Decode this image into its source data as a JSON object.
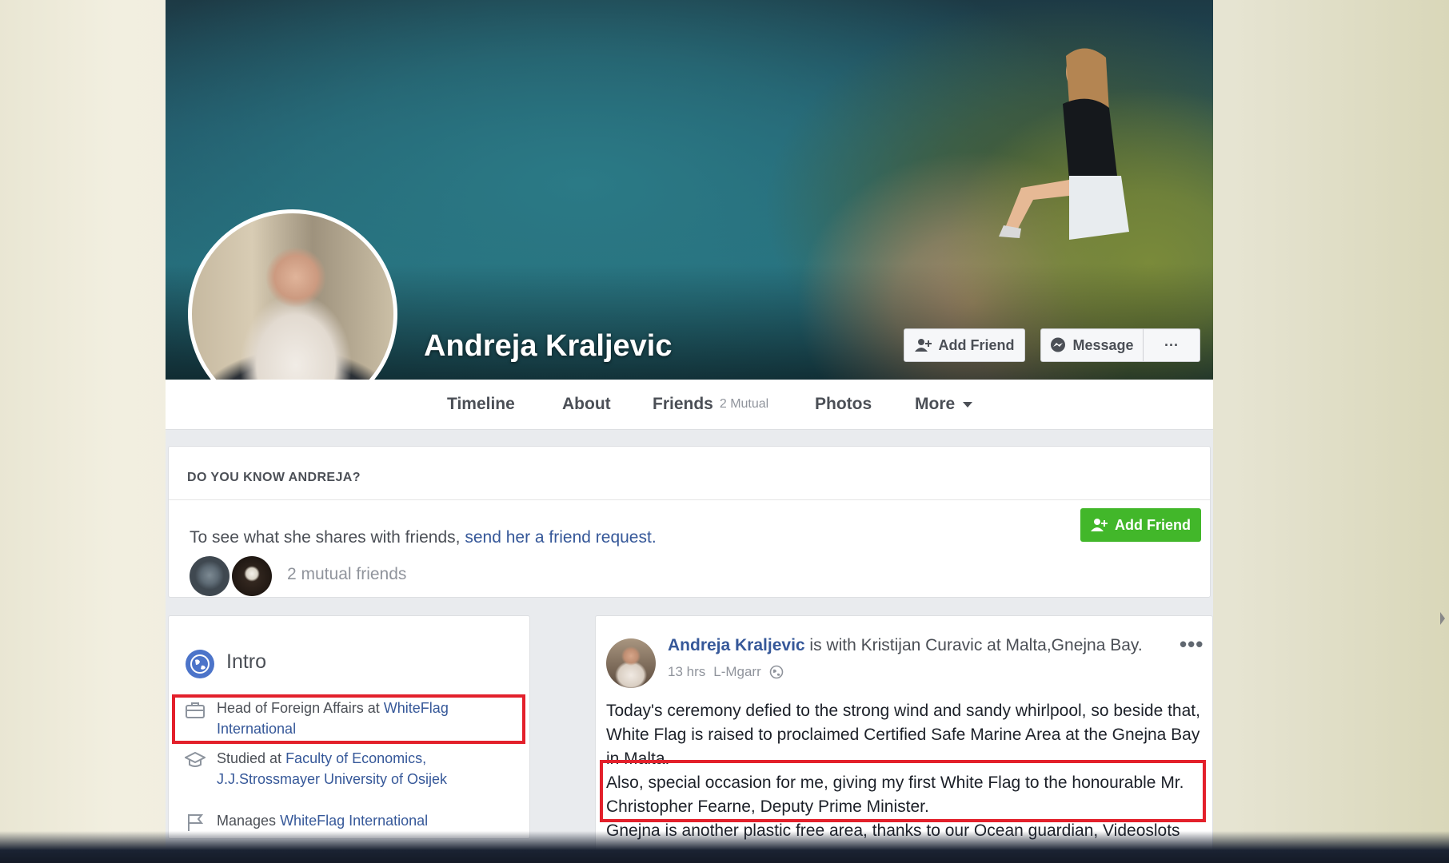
{
  "profile": {
    "name": "Andreja Kraljevic",
    "add_friend_label": "Add Friend",
    "message_label": "Message",
    "more_dots": "···"
  },
  "nav": {
    "timeline": "Timeline",
    "about": "About",
    "friends": "Friends",
    "friends_mutual": "2 Mutual",
    "photos": "Photos",
    "more": "More"
  },
  "know": {
    "title": "DO YOU KNOW ANDREJA?",
    "text_prefix": "To see what she shares with friends, ",
    "text_link": "send her a friend request.",
    "add_friend_label": "Add Friend",
    "mutual_friends": "2 mutual friends"
  },
  "intro": {
    "title": "Intro",
    "work_prefix": "Head of Foreign Affairs at ",
    "work_link": "WhiteFlag International",
    "edu_prefix": "Studied at ",
    "edu_link": "Faculty of Economics, J.J.Strossmayer University of Osijek",
    "manages_prefix": "Manages ",
    "manages_link": "WhiteFlag International"
  },
  "post": {
    "author": "Andreja Kraljevic",
    "header_rest": " is with Kristijan Curavic at Malta,Gnejna Bay.",
    "time": "13 hrs",
    "location": "L-Mgarr",
    "menu_dots": "•••",
    "paragraph1": "Today's ceremony defied to the strong wind and sandy whirlpool, so beside that, White Flag is raised to proclaimed Certified Safe Marine Area at the Gnejna Bay in Malta.",
    "paragraph2": "Also, special occasion for me, giving my first White Flag to the honourable Mr. Christopher Fearne, Deputy Prime Minister.",
    "paragraph3": "Gnejna is another plastic free area, thanks to our Ocean guardian, Videoslots"
  },
  "colors": {
    "link": "#365899",
    "green_button": "#42b72a",
    "highlight_box": "#e3202b"
  }
}
